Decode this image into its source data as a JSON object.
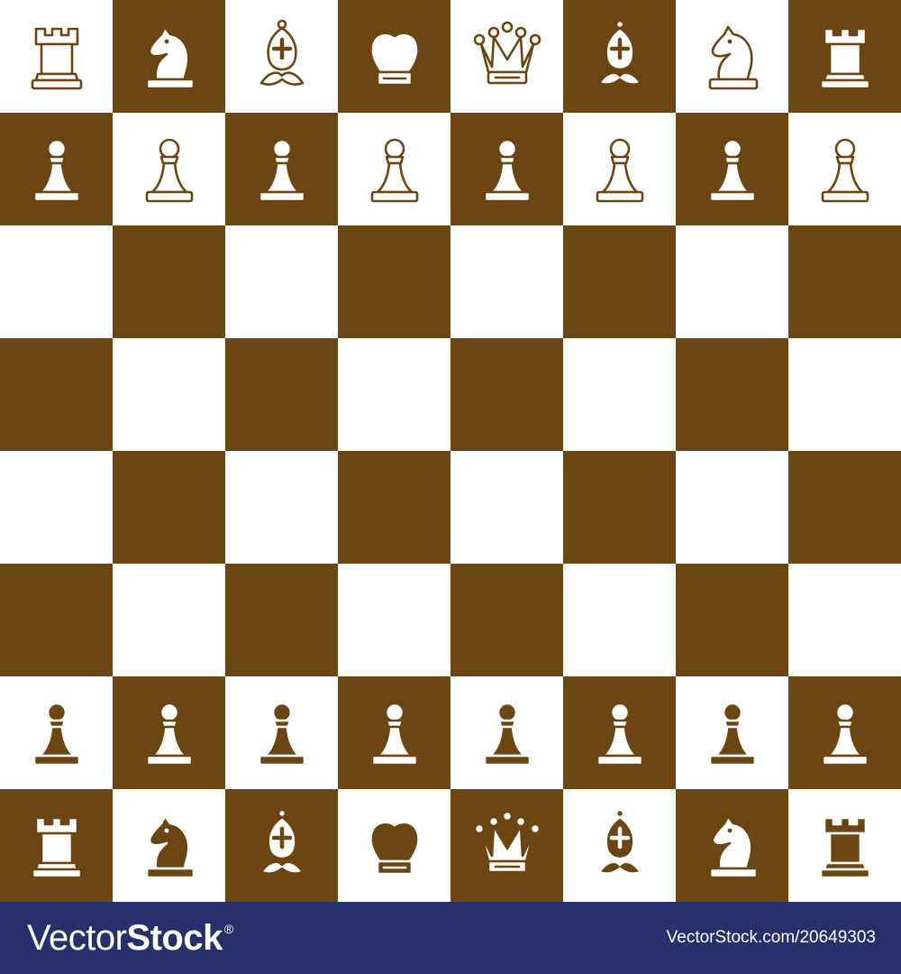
{
  "colors": {
    "dark_square": "#6b4512",
    "light_square": "#ffffff",
    "piece_fill_on_light": "#ffffff",
    "piece_fill_on_dark": "#ffffff",
    "piece_stroke_on_light": "#6b4512",
    "piece_stroke_on_dark": "#6b4512",
    "footer_bg": "#26306b"
  },
  "board": {
    "ranks": [
      [
        "rook",
        "knight",
        "bishop",
        "king",
        "queen",
        "bishop",
        "knight",
        "rook"
      ],
      [
        "pawn",
        "pawn",
        "pawn",
        "pawn",
        "pawn",
        "pawn",
        "pawn",
        "pawn"
      ],
      [
        "",
        "",
        "",
        "",
        "",
        "",
        "",
        ""
      ],
      [
        "",
        "",
        "",
        "",
        "",
        "",
        "",
        ""
      ],
      [
        "",
        "",
        "",
        "",
        "",
        "",
        "",
        ""
      ],
      [
        "",
        "",
        "",
        "",
        "",
        "",
        "",
        ""
      ],
      [
        "pawn",
        "pawn",
        "pawn",
        "pawn",
        "pawn",
        "pawn",
        "pawn",
        "pawn"
      ],
      [
        "rook",
        "knight",
        "bishop",
        "king",
        "queen",
        "bishop",
        "knight",
        "rook"
      ]
    ],
    "colors": [
      [
        "light",
        "light",
        "light",
        "light",
        "light",
        "light",
        "light",
        "light"
      ],
      [
        "light",
        "light",
        "light",
        "light",
        "light",
        "light",
        "light",
        "light"
      ],
      [
        "",
        "",
        "",
        "",
        "",
        "",
        "",
        ""
      ],
      [
        "",
        "",
        "",
        "",
        "",
        "",
        "",
        ""
      ],
      [
        "",
        "",
        "",
        "",
        "",
        "",
        "",
        ""
      ],
      [
        "",
        "",
        "",
        "",
        "",
        "",
        "",
        ""
      ],
      [
        "dark",
        "dark",
        "dark",
        "dark",
        "dark",
        "dark",
        "dark",
        "dark"
      ],
      [
        "dark",
        "dark",
        "dark",
        "dark",
        "dark",
        "dark",
        "dark",
        "dark"
      ]
    ]
  },
  "watermark": {
    "brand_light": "Vector",
    "brand_bold": "Stock",
    "brand_mark": "®",
    "image_id": "VectorStock.com/20649303"
  }
}
